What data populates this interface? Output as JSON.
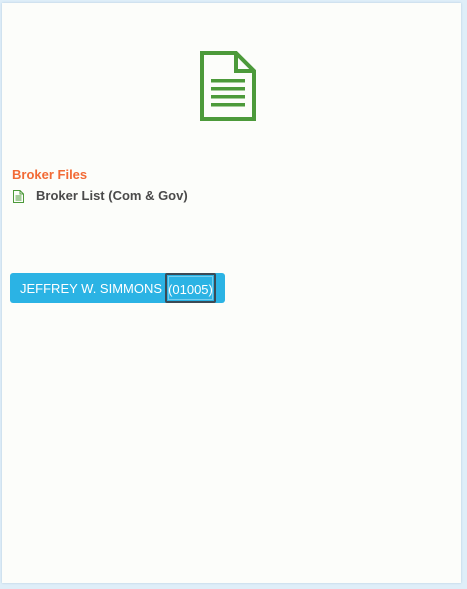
{
  "hero": {
    "icon": "document-icon",
    "color": "#4c9a3a"
  },
  "broker_files": {
    "title": "Broker Files",
    "title_color": "#f26a35",
    "items": [
      {
        "label": "Broker List (Com & Gov)",
        "icon": "document-small-icon"
      }
    ]
  },
  "broker": {
    "name": "JEFFREY W. SIMMONS",
    "code": "(01005)",
    "button_color": "#2bb3e4"
  }
}
